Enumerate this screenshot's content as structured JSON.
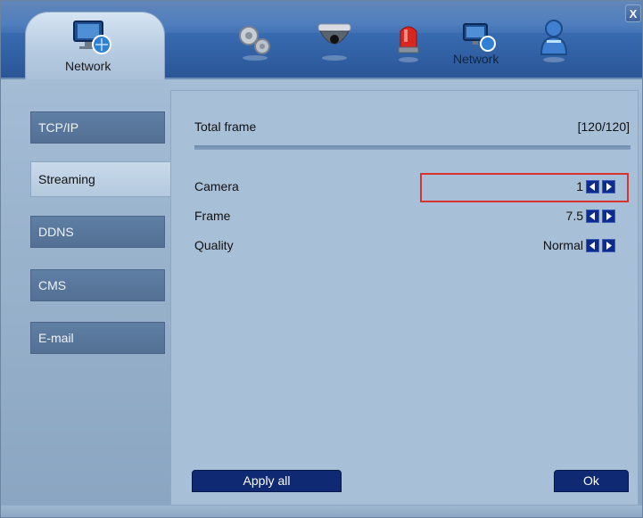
{
  "window": {
    "close_label": "X"
  },
  "toolbar": {
    "active_tab_label": "Network",
    "tabs": [
      {
        "icon": "gears-icon"
      },
      {
        "icon": "dome-camera-icon"
      },
      {
        "icon": "alarm-siren-icon"
      },
      {
        "icon": "network-icon",
        "label": "Network"
      },
      {
        "icon": "user-icon"
      }
    ]
  },
  "sidebar": {
    "items": [
      {
        "label": "TCP/IP"
      },
      {
        "label": "Streaming",
        "active": true
      },
      {
        "label": "DDNS"
      },
      {
        "label": "CMS"
      },
      {
        "label": "E-mail"
      }
    ]
  },
  "main": {
    "total_frame_label": "Total frame",
    "total_frame_value": "[120/120]",
    "rows": [
      {
        "label": "Camera",
        "value": "1"
      },
      {
        "label": "Frame",
        "value": "7.5"
      },
      {
        "label": "Quality",
        "value": "Normal"
      }
    ],
    "apply_all_label": "Apply all",
    "ok_label": "Ok"
  },
  "colors": {
    "accent": "#0f2a73",
    "highlight": "#d8332f",
    "toolbar": "#2d5ea3"
  }
}
